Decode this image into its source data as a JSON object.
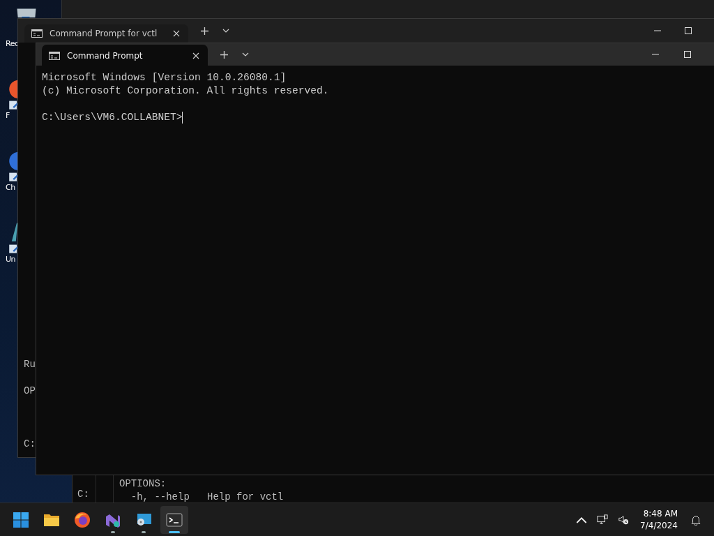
{
  "desktop_icons": [
    {
      "label": "Rec",
      "kind": "bin"
    },
    {
      "label": "F",
      "kind": "orange"
    },
    {
      "label": "Ch",
      "kind": "blue"
    },
    {
      "label": "Un",
      "kind": "teal"
    }
  ],
  "back_window": {
    "tab_title": "Command Prompt for vctl",
    "console_lines": [
      "Ru",
      "OP",
      "C:"
    ]
  },
  "lower_window": {
    "pane_1_lines": [
      "C:"
    ],
    "pane_2_lines": [
      "OPTIONS:",
      "  -h, --help   Help for vctl"
    ]
  },
  "front_window": {
    "tab_title": "Command Prompt",
    "output_lines": [
      "Microsoft Windows [Version 10.0.26080.1]",
      "(c) Microsoft Corporation. All rights reserved."
    ],
    "prompt": "C:\\Users\\VM6.COLLABNET>"
  },
  "taskbar": {
    "apps": [
      {
        "kind": "start",
        "running": false,
        "selected": false
      },
      {
        "kind": "folder",
        "running": false,
        "selected": false
      },
      {
        "kind": "firefox",
        "running": false,
        "selected": false
      },
      {
        "kind": "studio",
        "running": true,
        "selected": false
      },
      {
        "kind": "remote",
        "running": true,
        "selected": false
      },
      {
        "kind": "terminal",
        "running": true,
        "selected": true
      }
    ],
    "time": "8:48 AM",
    "date": "7/4/2024"
  }
}
